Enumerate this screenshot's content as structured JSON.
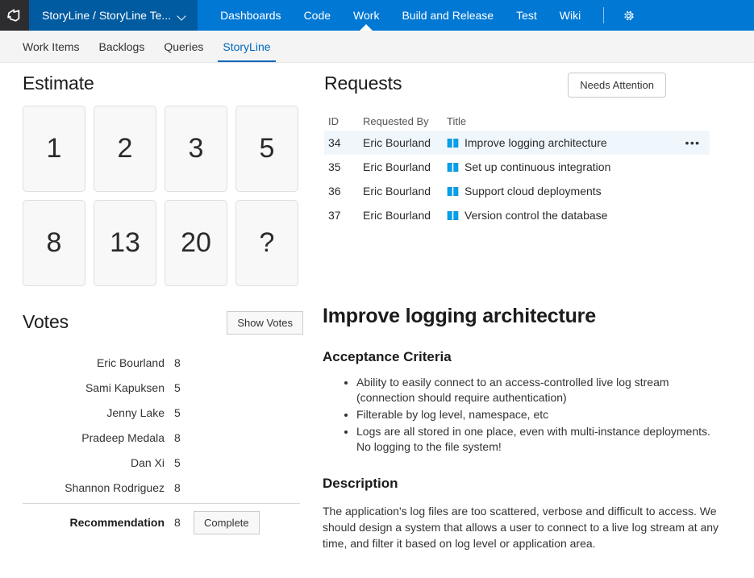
{
  "topbar": {
    "logo_icon": "azure-devops-logo-icon",
    "project": "StoryLine / StoryLine Te...",
    "chevron_icon": "chevron-down-icon",
    "nav_items": [
      {
        "label": "Dashboards",
        "active": false
      },
      {
        "label": "Code",
        "active": false
      },
      {
        "label": "Work",
        "active": true
      },
      {
        "label": "Build and Release",
        "active": false
      },
      {
        "label": "Test",
        "active": false
      },
      {
        "label": "Wiki",
        "active": false
      }
    ],
    "gear_icon": "gear-icon",
    "accent_color": "#0078d4",
    "project_color": "#005ba1",
    "logo_bg_color": "#2d2d30"
  },
  "subnav": {
    "items": [
      {
        "label": "Work Items",
        "active": false
      },
      {
        "label": "Backlogs",
        "active": false
      },
      {
        "label": "Queries",
        "active": false
      },
      {
        "label": "StoryLine",
        "active": true
      }
    ],
    "active_color": "#0067b8"
  },
  "estimate": {
    "title": "Estimate",
    "cards": [
      "1",
      "2",
      "3",
      "5",
      "8",
      "13",
      "20",
      "?"
    ]
  },
  "votes": {
    "title": "Votes",
    "show_votes_label": "Show Votes",
    "rows": [
      {
        "name": "Eric Bourland",
        "value": "8"
      },
      {
        "name": "Sami Kapuksen",
        "value": "5"
      },
      {
        "name": "Jenny Lake",
        "value": "5"
      },
      {
        "name": "Pradeep Medala",
        "value": "8"
      },
      {
        "name": "Dan Xi",
        "value": "5"
      },
      {
        "name": "Shannon Rodriguez",
        "value": "8"
      }
    ],
    "recommendation_label": "Recommendation",
    "recommendation_value": "8",
    "complete_label": "Complete"
  },
  "requests": {
    "title": "Requests",
    "needs_attention_label": "Needs Attention",
    "columns": [
      "ID",
      "Requested By",
      "Title"
    ],
    "rows": [
      {
        "id": "34",
        "requested_by": "Eric Bourland",
        "title": "Improve logging architecture",
        "icon": "feature-book-icon",
        "selected": true,
        "menu": "•••"
      },
      {
        "id": "35",
        "requested_by": "Eric Bourland",
        "title": "Set up continuous integration",
        "icon": "feature-book-icon",
        "selected": false,
        "menu": ""
      },
      {
        "id": "36",
        "requested_by": "Eric Bourland",
        "title": "Support cloud deployments",
        "icon": "feature-book-icon",
        "selected": false,
        "menu": ""
      },
      {
        "id": "37",
        "requested_by": "Eric Bourland",
        "title": "Version control the database",
        "icon": "feature-book-icon",
        "selected": false,
        "menu": ""
      }
    ],
    "selected_row_color": "#eff6fc",
    "icon_color": "#00a2ed"
  },
  "detail": {
    "title": "Improve logging architecture",
    "acceptance_heading": "Acceptance Criteria",
    "acceptance_items": [
      "Ability to easily connect to an access-controlled live log stream (connection should require authentication)",
      "Filterable by log level, namespace, etc",
      "Logs are all stored in one place, even with multi-instance deployments. No logging to the file system!"
    ],
    "description_heading": "Description",
    "description_text": "The application's log files are too scattered, verbose and difficult to access. We should design a system that allows a user to connect to a live log stream at any time, and filter it based on log level or application area."
  }
}
